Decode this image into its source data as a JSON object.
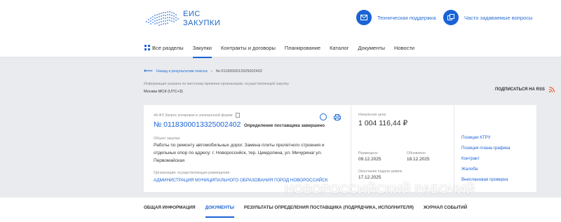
{
  "header": {
    "logo_line1": "ЕИС",
    "logo_line2": "ЗАКУПКИ",
    "support_label": "Техническая поддержка",
    "faq_label": "Часто задаваемые вопросы"
  },
  "nav": {
    "items": [
      {
        "label": "Все разделы"
      },
      {
        "label": "Закупки"
      },
      {
        "label": "Контракты и договоры"
      },
      {
        "label": "Планирование"
      },
      {
        "label": "Каталог"
      },
      {
        "label": "Документы"
      },
      {
        "label": "Новости"
      }
    ],
    "active_index": 1
  },
  "breadcrumb": {
    "back_label": "Назад к результатам поиска",
    "current": "№ 0118300013325002402"
  },
  "timezone": {
    "note": "Информация указана по местному времени организации, осуществляющей закупку",
    "value": "Москва МСК (UTC+3)"
  },
  "rss_label": "ПОДПИСАТЬСЯ НА RSS",
  "card": {
    "procedure_type": "44-ФЗ Запрос котировок в электронной форме",
    "number": "№ 0118300013325002402",
    "status": "Определение поставщика завершено",
    "object_label": "Объект закупки",
    "object_text": "Работы по ремонту автомобильных дорог. Замена плиты пролетного строения и отдельных опор по адресу: г. Новороссийск, тер. Цемдолина, ул. Мичурина/ ул. Первомайская",
    "org_label": "Организация, осуществляющая размещение",
    "org_name": "АДМИНИСТРАЦИЯ МУНИЦИПАЛЬНОГО ОБРАЗОВАНИЯ ГОРОД НОВОРОССИЙСК",
    "price_label": "Начальная цена",
    "price": "1 004 116,44 ₽",
    "posted_label": "Размещено",
    "posted_date": "09.12.2025",
    "updated_label": "Обновлено",
    "updated_date": "18.12.2025",
    "deadline_label": "Окончание подачи заявок",
    "deadline_date": "17.12.2025",
    "links": [
      {
        "label": "Позиции КТРУ"
      },
      {
        "label": "Позиция плана-графика"
      },
      {
        "label": "Контракт"
      },
      {
        "label": "Жалоба"
      },
      {
        "label": "Внеплановая проверка"
      }
    ]
  },
  "watermark": "НОВОРОССИЙСКИЙ РАБОЧИЙ",
  "tabs": [
    {
      "label": "ОБЩАЯ ИНФОРМАЦИЯ"
    },
    {
      "label": "ДОКУМЕНТЫ"
    },
    {
      "label": "РЕЗУЛЬТАТЫ ОПРЕДЕЛЕНИЯ ПОСТАВЩИКА (ПОДРЯДЧИКА, ИСПОЛНИТЕЛЯ)"
    },
    {
      "label": "ЖУРНАЛ СОБЫТИЙ"
    }
  ],
  "active_tab": 1,
  "colors": {
    "accent": "#1a63d6",
    "page_bg": "#e9ebee",
    "rss": "#e8532b"
  }
}
